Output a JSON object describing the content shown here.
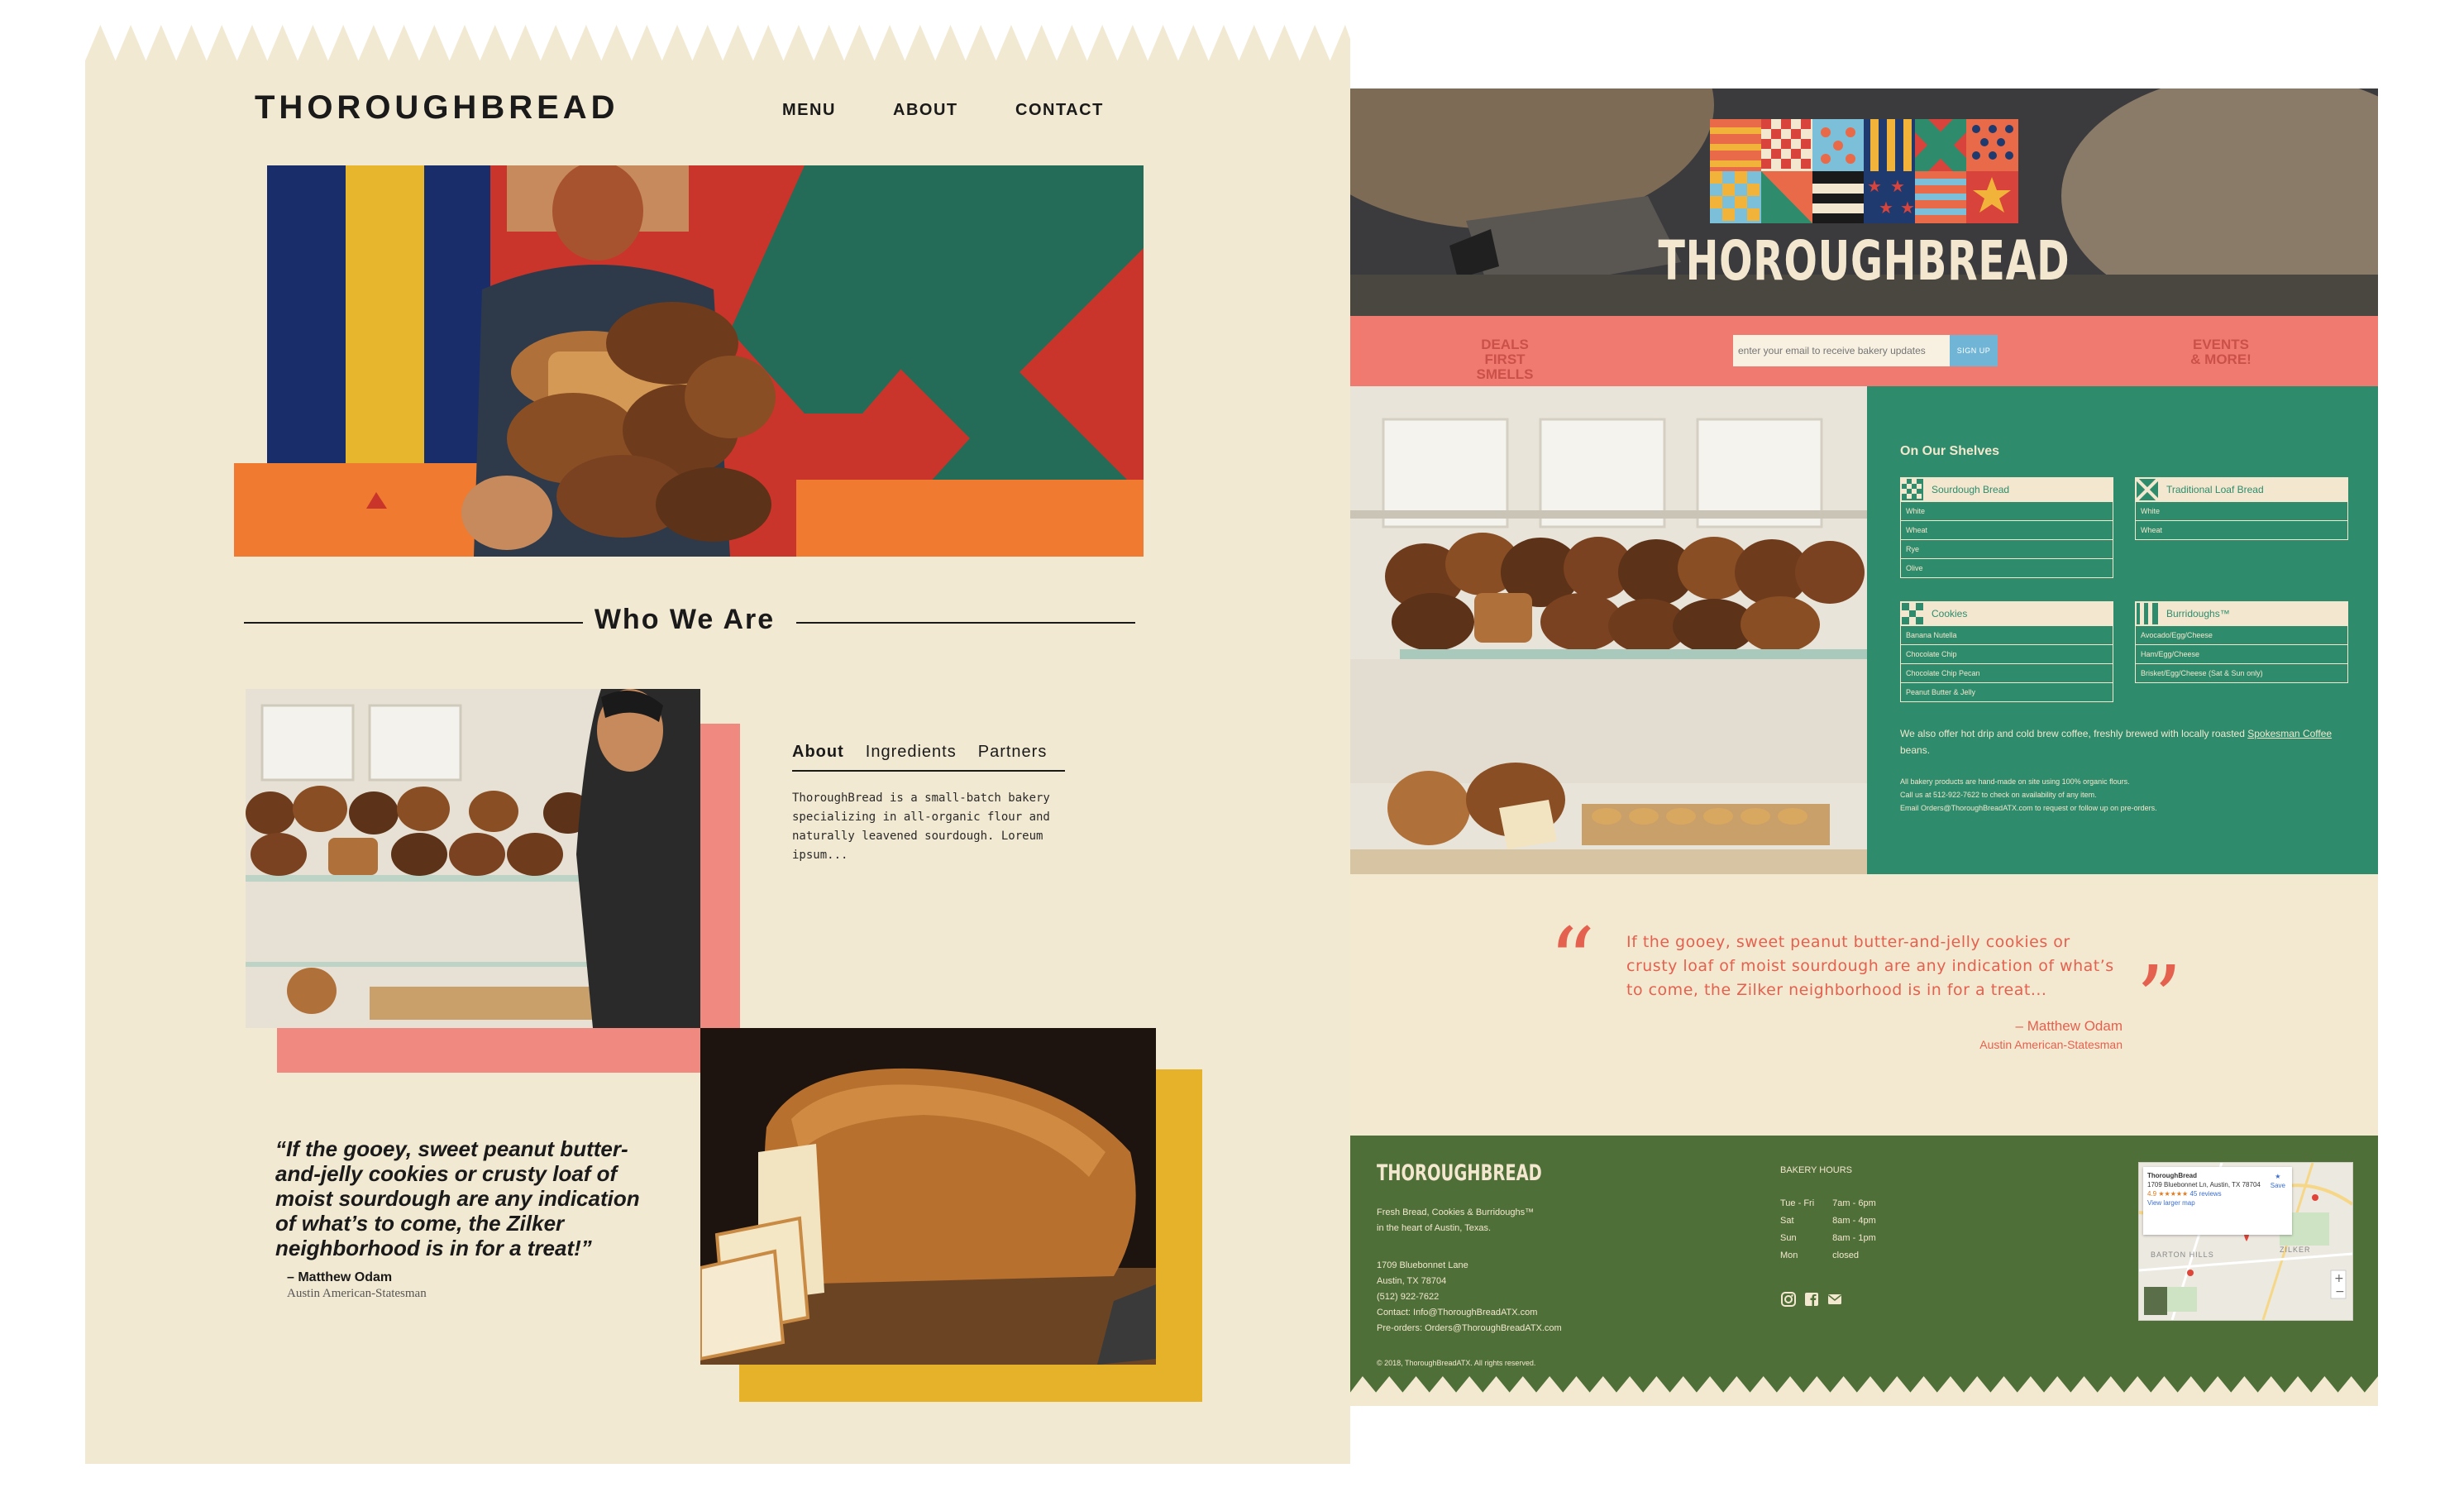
{
  "colors": {
    "cream": "#f2e9d2",
    "coral": "#f17a70",
    "gold": "#e6b22a",
    "green": "#2e8c6c",
    "olive": "#4f6f38",
    "quote_red": "#e5614f"
  },
  "left_site": {
    "brand": "THOROUGHBREAD",
    "nav": [
      "MENU",
      "ABOUT",
      "CONTACT"
    ],
    "section_title": "Who We Are",
    "tabs": [
      "About",
      "Ingredients",
      "Partners"
    ],
    "active_tab": "About",
    "about_text": "ThoroughBread is a small-batch bakery specializing in all-organic flour and naturally leavened sourdough. Loreum ipsum...",
    "quote": "“If the gooey, sweet peanut butter-and-jelly cookies or crusty loaf of moist sourdough are any indication of what’s to come, the Zilker neighborhood is in for a treat!”",
    "quote_author": "– Matthew Odam",
    "quote_source": "Austin American-Statesman"
  },
  "right_site": {
    "brand": "THOROUGHBREAD",
    "signup": {
      "left_text_1": "DEALS",
      "left_text_2": "FIRST SMELLS",
      "placeholder": "enter your email to receive bakery updates",
      "button": "SIGN UP",
      "right_text_1": "EVENTS",
      "right_text_2": "& MORE!"
    },
    "shelves": {
      "title": "On Our Shelves",
      "categories": [
        {
          "name": "Sourdough Bread",
          "icon": "checker-icon",
          "items": [
            "White",
            "Wheat",
            "Rye",
            "Olive"
          ]
        },
        {
          "name": "Traditional Loaf Bread",
          "icon": "x-icon",
          "items": [
            "White",
            "Wheat"
          ]
        },
        {
          "name": "Cookies",
          "icon": "checker-icon",
          "items": [
            "Banana Nutella",
            "Chocolate Chip",
            "Chocolate Chip Pecan",
            "Peanut Butter & Jelly"
          ]
        },
        {
          "name": "Burridoughs™",
          "icon": "stripes-icon",
          "items": [
            "Avocado/Egg/Cheese",
            "Ham/Egg/Cheese",
            "Brisket/Egg/Cheese (Sat & Sun only)"
          ]
        }
      ],
      "coffee_pre": "We also offer hot drip and cold brew coffee, freshly brewed with locally roasted ",
      "coffee_link": "Spokesman Coffee",
      "coffee_post": " beans.",
      "fine_1": "All bakery products are hand-made on site using 100% organic flours.",
      "fine_2": "Call us at 512-922-7622 to check on availability of any item.",
      "fine_3": "Email Orders@ThoroughBreadATX.com to request or follow up on pre-orders."
    },
    "quote": {
      "text": "If the gooey, sweet peanut butter-and-jelly cookies or crusty loaf of moist sourdough are any indication of what’s to come, the Zilker neighborhood is in for a treat...",
      "author": "– Matthew Odam",
      "source": "Austin American-Statesman"
    },
    "footer": {
      "brand": "THOROUGHBREAD",
      "tagline_1": "Fresh Bread, Cookies & Burridoughs™",
      "tagline_2": "in the heart of Austin, Texas.",
      "address_1": "1709 Bluebonnet Lane",
      "address_2": "Austin, TX 78704",
      "phone": "(512) 922-7622",
      "contact": "Contact: Info@ThoroughBreadATX.com",
      "preorders": "Pre-orders: Orders@ThoroughBreadATX.com",
      "copyright": "© 2018, ThoroughBreadATX. All rights reserved.",
      "hours_title": "BAKERY HOURS",
      "hours": [
        {
          "day": "Tue - Fri",
          "time": "7am - 6pm"
        },
        {
          "day": "Sat",
          "time": "8am - 4pm"
        },
        {
          "day": "Sun",
          "time": "8am - 1pm"
        },
        {
          "day": "Mon",
          "time": "closed"
        }
      ],
      "social_icons": [
        "instagram-icon",
        "facebook-icon",
        "email-icon"
      ],
      "map": {
        "place": "ThoroughBread",
        "address": "1709 Bluebonnet Ln, Austin, TX 78704",
        "rating": "4.9 ★★★★★",
        "reviews": "45 reviews",
        "view_larger": "View larger map",
        "save": "Save",
        "label_zilker": "ZILKER",
        "label_barton": "BARTON HILLS"
      }
    }
  }
}
